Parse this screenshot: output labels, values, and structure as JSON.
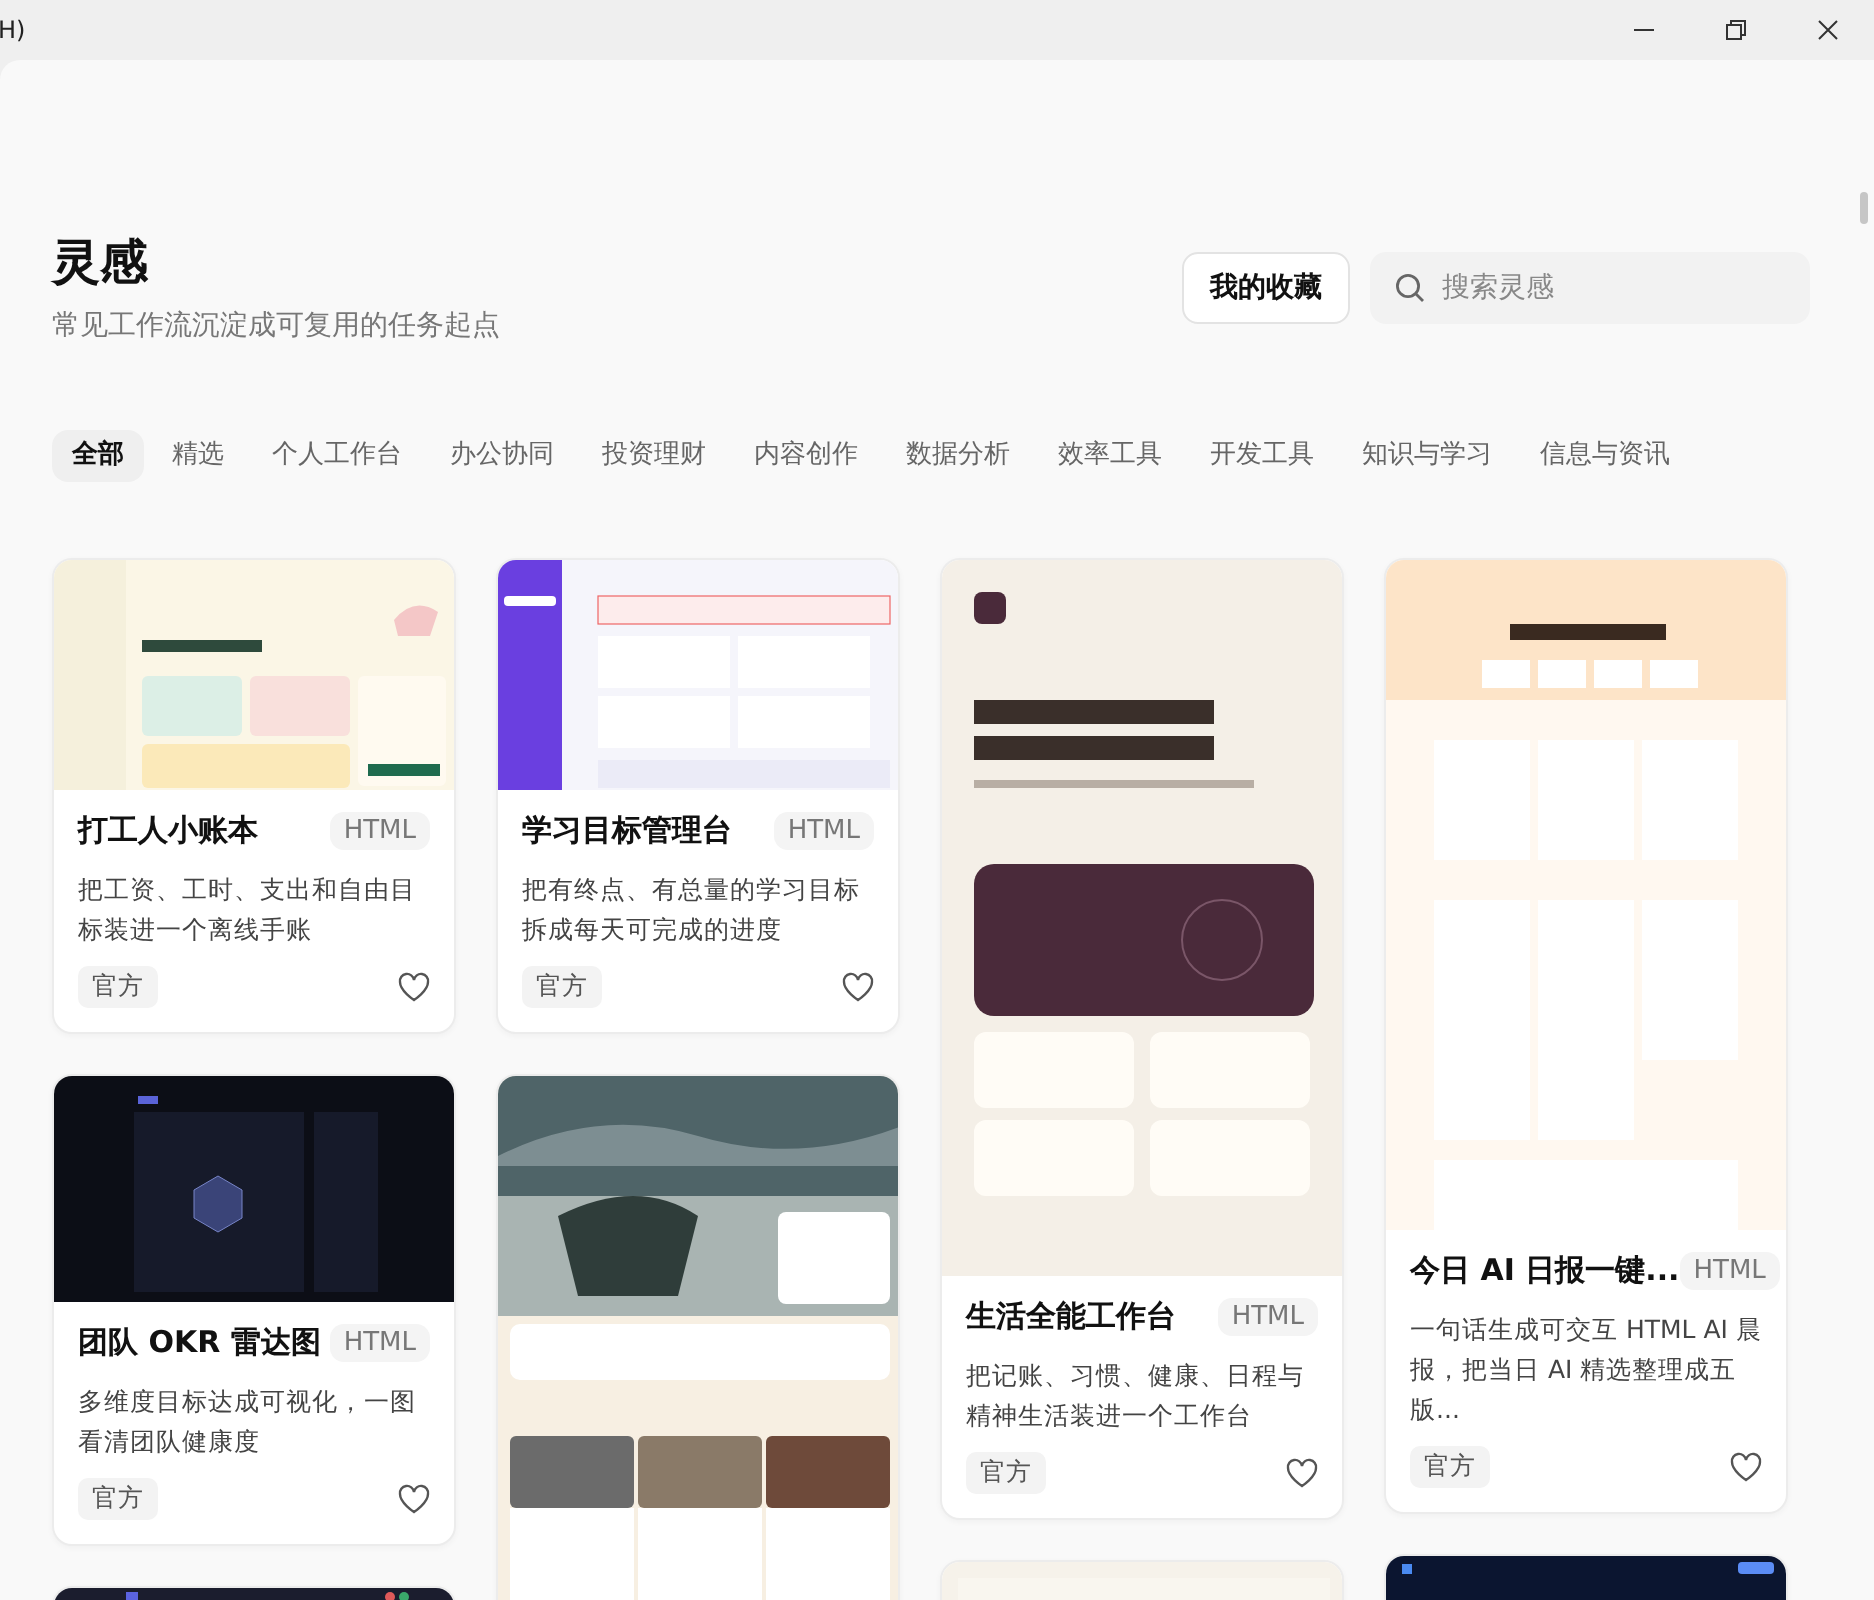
{
  "window": {
    "title": "H)"
  },
  "header": {
    "title": "灵感",
    "subtitle": "常见工作流沉淀成可复用的任务起点",
    "favorites_button": "我的收藏",
    "search": {
      "placeholder": "搜索灵感"
    }
  },
  "tabs": [
    {
      "label": "全部",
      "selected": true
    },
    {
      "label": "精选",
      "selected": false
    },
    {
      "label": "个人工作台",
      "selected": false
    },
    {
      "label": "办公协同",
      "selected": false
    },
    {
      "label": "投资理财",
      "selected": false
    },
    {
      "label": "内容创作",
      "selected": false
    },
    {
      "label": "数据分析",
      "selected": false
    },
    {
      "label": "效率工具",
      "selected": false
    },
    {
      "label": "开发工具",
      "selected": false
    },
    {
      "label": "知识与学习",
      "selected": false
    },
    {
      "label": "信息与资讯",
      "selected": false
    }
  ],
  "columns": [
    {
      "cards": [
        {
          "kind": "full",
          "title": "打工人小账本",
          "badge": "HTML",
          "description": "把工资、工时、支出和自由目标装进一个离线手账",
          "tag": "官方"
        },
        {
          "kind": "full",
          "title": "团队 OKR 雷达图",
          "badge": "HTML",
          "description": "多维度目标达成可视化，一图看清团队健康度",
          "tag": "官方"
        },
        {
          "kind": "preview"
        }
      ]
    },
    {
      "cards": [
        {
          "kind": "full",
          "title": "学习目标管理台",
          "badge": "HTML",
          "description": "把有终点、有总量的学习目标拆成每天可完成的进度",
          "tag": "官方"
        },
        {
          "kind": "preview"
        }
      ]
    },
    {
      "cards": [
        {
          "kind": "full",
          "title": "生活全能工作台",
          "badge": "HTML",
          "description": "把记账、习惯、健康、日程与精神生活装进一个工作台",
          "tag": "官方"
        },
        {
          "kind": "preview"
        }
      ]
    },
    {
      "cards": [
        {
          "kind": "full",
          "title": "今日 AI 日报一键...",
          "badge": "HTML",
          "description": "一句话生成可交互 HTML AI 晨报，把当日 AI 精选整理成五版...",
          "tag": "官方"
        },
        {
          "kind": "preview"
        }
      ]
    }
  ]
}
